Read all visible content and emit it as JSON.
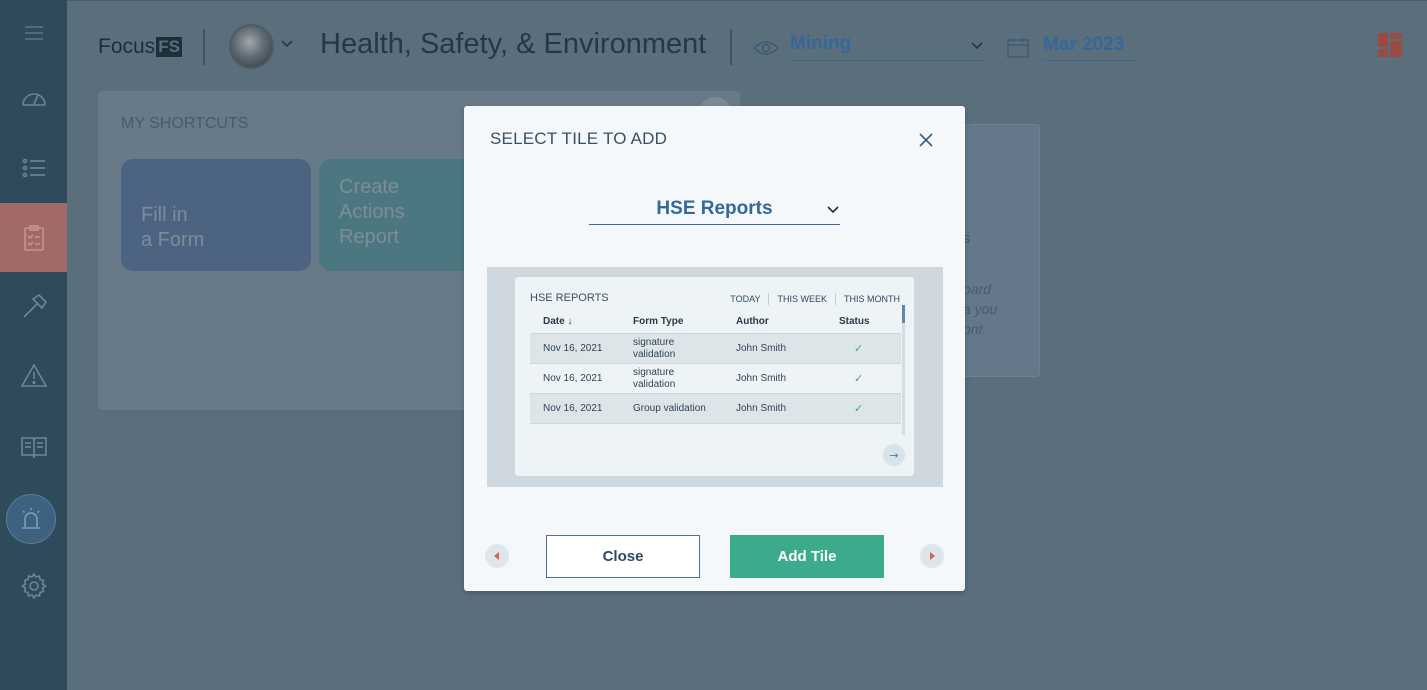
{
  "header": {
    "logo_text": "Focus",
    "logo_badge": "FS",
    "page_title": "Health, Safety, & Environment",
    "site_select": "Mining",
    "date": "Mar 2023"
  },
  "sidebar": {
    "items": [
      {
        "icon": "menu-icon"
      },
      {
        "icon": "dashboard-icon"
      },
      {
        "icon": "list-icon"
      },
      {
        "icon": "clipboard-icon",
        "active": true
      },
      {
        "icon": "hammer-icon"
      },
      {
        "icon": "warning-icon"
      },
      {
        "icon": "book-icon"
      },
      {
        "icon": "alarm-icon"
      },
      {
        "icon": "gear-icon"
      }
    ]
  },
  "shortcuts": {
    "title": "MY SHORTCUTS",
    "tiles": [
      {
        "label_line1": "Fill in",
        "label_line2": "a Form"
      },
      {
        "label_line1": "Create",
        "label_line2": "Actions",
        "label_line3": "Report"
      }
    ]
  },
  "right_card": {
    "text": "oard\na you\nont."
  },
  "modal": {
    "title": "SELECT TILE TO ADD",
    "tile_select": "HSE Reports",
    "close_label": "Close",
    "add_label": "Add Tile",
    "preview": {
      "title": "HSE REPORTS",
      "filters": [
        "TODAY",
        "THIS WEEK",
        "THIS MONTH"
      ],
      "columns": [
        "Date ↓",
        "Form Type",
        "Author",
        "Status"
      ],
      "rows": [
        {
          "date": "Nov 16, 2021",
          "form_line1": "signature",
          "form_line2": "validation",
          "author": "John Smith",
          "status": "✓"
        },
        {
          "date": "Nov 16, 2021",
          "form_line1": "signature",
          "form_line2": "validation",
          "author": "John Smith",
          "status": "✓"
        },
        {
          "date": "Nov 16, 2021",
          "form_line1": "Group validation",
          "form_line2": "",
          "author": "John Smith",
          "status": "✓"
        }
      ],
      "next_glyph": "→"
    }
  },
  "colors": {
    "accent_blue": "#34679a",
    "add_green": "#3caa8c",
    "active_sidebar": "#a06a68",
    "overlay_tint": "#5a6e7c"
  }
}
